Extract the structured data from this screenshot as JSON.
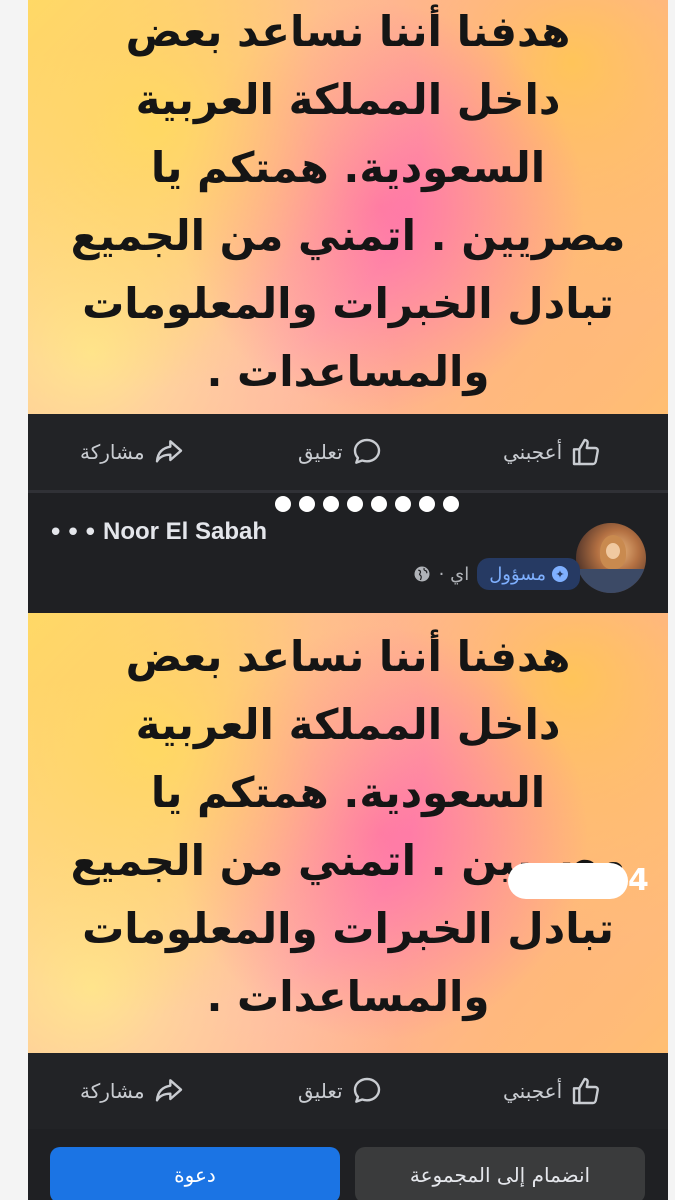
{
  "post_top": {
    "text_lines": [
      "هدفنا أننا نساعد بعض",
      "داخل المملكة العربية",
      "السعودية. همتكم يا",
      "مصريين . اتمني من الجميع",
      "تبادل الخبرات والمعلومات",
      "والمساعدات ."
    ]
  },
  "action_bar_top": {
    "like_label": "أعجبني",
    "comment_label": "تعليق",
    "share_label": "مشاركة"
  },
  "post_header": {
    "author_name": "Noor El Sabah",
    "role_badge": "مسؤول",
    "time_text": "اي ·",
    "menu_dots": "•••"
  },
  "post_bottom": {
    "text_lines": [
      "هدفنا أننا نساعد بعض",
      "داخل المملكة العربية",
      "السعودية. همتكم يا",
      "مصريين . اتمني من الجميع",
      "تبادل الخبرات والمعلومات",
      "والمساعدات ."
    ],
    "overlay_digit": "4"
  },
  "action_bar_bottom": {
    "like_label": "أعجبني",
    "comment_label": "تعليق",
    "share_label": "مشاركة"
  },
  "group_actions": {
    "invite_label": "دعوة",
    "join_label": "انضمام إلى المجموعة"
  },
  "colors": {
    "accent": "#1b74e4",
    "background": "#1f2023",
    "badge_bg": "#263a63",
    "badge_text": "#7fb0ff"
  },
  "icons": {
    "like": "thumbs-up-icon",
    "comment": "comment-bubble-icon",
    "share": "share-arrow-icon",
    "globe": "globe-icon",
    "badge": "admin-star-icon",
    "more": "more-dots-icon"
  }
}
